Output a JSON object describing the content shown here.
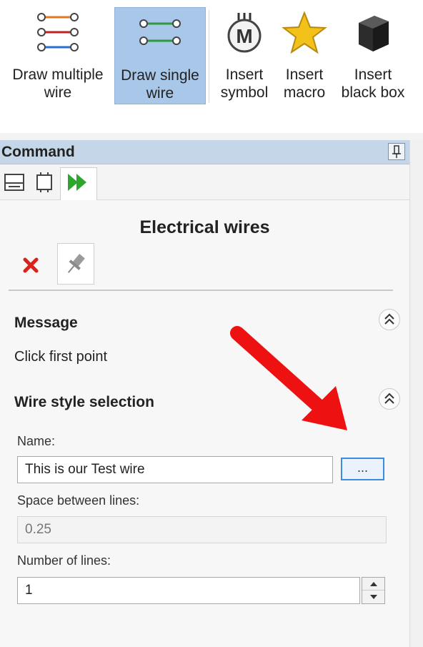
{
  "ribbon": {
    "buttons": [
      {
        "label": "Draw multiple\nwire",
        "icon": "multiple-wire-icon",
        "active": false
      },
      {
        "label": "Draw single\nwire",
        "icon": "single-wire-icon",
        "active": true
      },
      {
        "label": "Insert\nsymbol",
        "icon": "symbol-icon",
        "active": false
      },
      {
        "label": "Insert\nmacro",
        "icon": "star-macro-icon",
        "active": false
      },
      {
        "label": "Insert\nblack box",
        "icon": "black-box-icon",
        "active": false
      }
    ]
  },
  "command_panel": {
    "title": "Command",
    "tabs": [
      "list-tab",
      "component-tab",
      "run-tab"
    ],
    "panel_title": "Electrical wires"
  },
  "message_section": {
    "title": "Message",
    "text": "Click first point"
  },
  "wire_style": {
    "title": "Wire style selection",
    "name_label": "Name:",
    "name_value": "This is our Test wire",
    "browse_label": "...",
    "space_label": "Space between lines:",
    "space_value": "0.25",
    "lines_label": "Number of lines:",
    "lines_value": "1"
  },
  "colors": {
    "active_ribbon": "#a9c7e8",
    "header": "#c4d6e8",
    "arrow": "#ee1111",
    "browse_border": "#3c8be0"
  }
}
